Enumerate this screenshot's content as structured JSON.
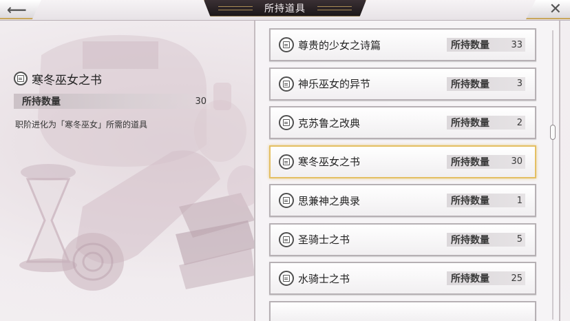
{
  "header": {
    "title": "所持道具",
    "back_icon": "back-arrow-icon",
    "close_icon": "close-icon"
  },
  "detail": {
    "name": "寒冬巫女之书",
    "qty_label": "所持数量",
    "qty_value": "30",
    "description": "职阶进化为「寒冬巫女」所需的道具"
  },
  "list": {
    "items": [
      {
        "name": "尊贵的少女之诗篇",
        "qty_label": "所持数量",
        "qty": "33",
        "selected": false
      },
      {
        "name": "神乐巫女的异节",
        "qty_label": "所持数量",
        "qty": "3",
        "selected": false
      },
      {
        "name": "克苏鲁之改典",
        "qty_label": "所持数量",
        "qty": "2",
        "selected": false
      },
      {
        "name": "寒冬巫女之书",
        "qty_label": "所持数量",
        "qty": "30",
        "selected": true
      },
      {
        "name": "思兼神之典录",
        "qty_label": "所持数量",
        "qty": "1",
        "selected": false
      },
      {
        "name": "圣骑士之书",
        "qty_label": "所持数量",
        "qty": "5",
        "selected": false
      },
      {
        "name": "水骑士之书",
        "qty_label": "所持数量",
        "qty": "25",
        "selected": false
      }
    ]
  },
  "colors": {
    "selected_border": "#e4bf63",
    "title_plate": "#1c1719",
    "accent_gold": "#c9a65a"
  }
}
